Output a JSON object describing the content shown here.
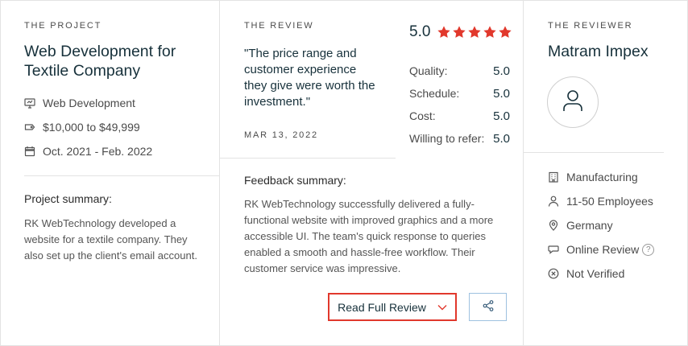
{
  "project": {
    "section_label": "THE PROJECT",
    "title_line1": "Web Development for",
    "title_line2": "Textile Company",
    "service": "Web Development",
    "budget": "$10,000 to $49,999",
    "timeline": "Oct. 2021 - Feb. 2022",
    "summary_heading": "Project summary:",
    "summary_text": "RK WebTechnology developed a website for a textile company. They also set up the client's email account."
  },
  "review": {
    "section_label": "THE REVIEW",
    "quote": "\"The price range and customer experience they give were worth the investment.\"",
    "date": "MAR 13, 2022",
    "feedback_heading": "Feedback summary:",
    "feedback_text": "RK WebTechnology successfully delivered a fully-functional website with improved graphics and a more accessible UI. The team's quick response to queries enabled a smooth and hassle-free workflow. Their customer service was impressive.",
    "overall_rating": "5.0",
    "stars": 5,
    "star_color": "#e1382c",
    "scores": [
      {
        "label": "Quality:",
        "value": "5.0"
      },
      {
        "label": "Schedule:",
        "value": "5.0"
      },
      {
        "label": "Cost:",
        "value": "5.0"
      },
      {
        "label": "Willing to refer:",
        "value": "5.0"
      }
    ],
    "read_button": "Read Full Review"
  },
  "reviewer": {
    "section_label": "THE REVIEWER",
    "name": "Matram Impex",
    "details": [
      {
        "icon": "building-icon",
        "text": "Manufacturing"
      },
      {
        "icon": "person-icon",
        "text": "11-50 Employees"
      },
      {
        "icon": "location-pin-icon",
        "text": "Germany"
      },
      {
        "icon": "chat-bubble-icon",
        "text": "Online Review"
      },
      {
        "icon": "x-circle-icon",
        "text": "Not Verified"
      }
    ],
    "help_glyph": "?"
  },
  "colors": {
    "accent_red": "#e1382c",
    "title_dark": "#17313b",
    "share_border": "#9ec1e0"
  }
}
